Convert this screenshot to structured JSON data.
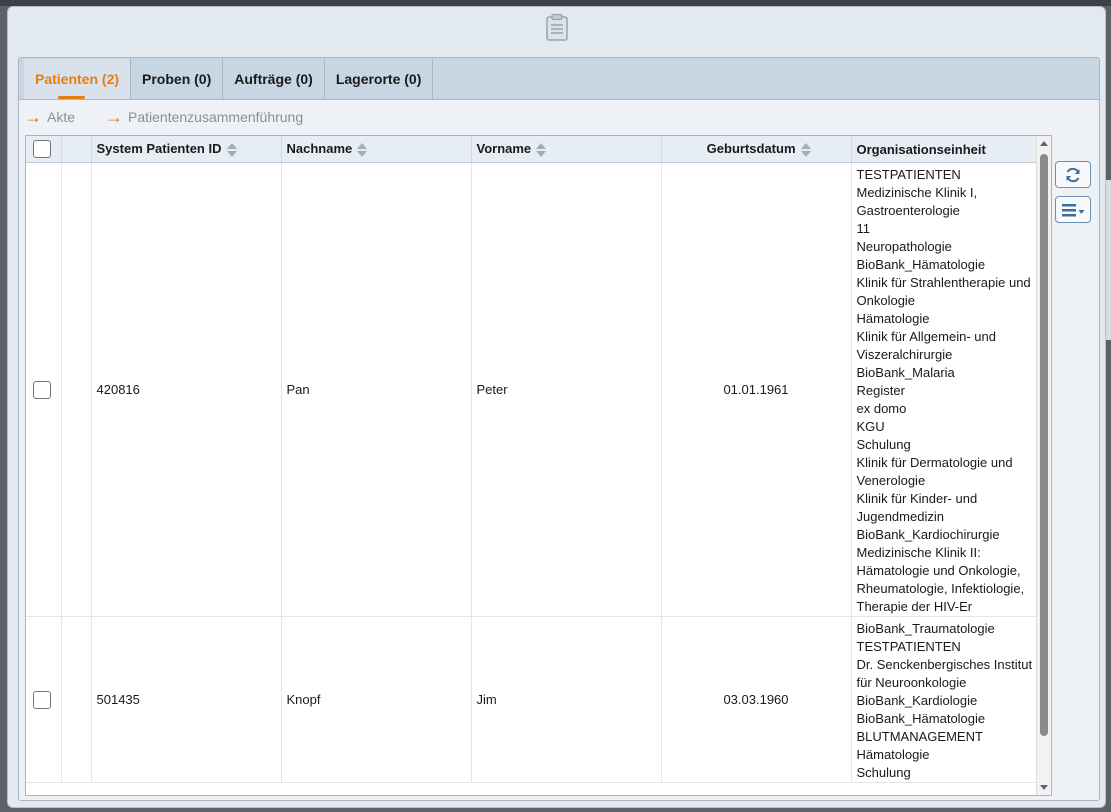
{
  "tabs": [
    {
      "label": "Patienten (2)"
    },
    {
      "label": "Proben (0)"
    },
    {
      "label": "Aufträge (0)"
    },
    {
      "label": "Lagerorte (0)"
    }
  ],
  "actions": {
    "akte_label": "Akte",
    "merge_label": "Patientenzusammenführung"
  },
  "table": {
    "columns": {
      "system_id": "System Patienten ID",
      "nachname": "Nachname",
      "vorname": "Vorname",
      "geburtsdatum": "Geburtsdatum",
      "org": "Organisationseinheit"
    },
    "rows": [
      {
        "system_id": "420816",
        "nachname": "Pan",
        "vorname": "Peter",
        "geburtsdatum": "01.01.1961",
        "org": [
          "TESTPATIENTEN",
          "Medizinische Klinik I, Gastroenterologie",
          "11",
          "Neuropathologie",
          "BioBank_Hämatologie",
          "Klinik für Strahlentherapie und Onkologie",
          "Hämatologie",
          "Klinik für Allgemein- und Viszeralchirurgie",
          "BioBank_Malaria",
          "Register",
          "ex domo",
          "KGU",
          "Schulung",
          "Klinik für Dermatologie und Venerologie",
          "Klinik für Kinder- und Jugendmedizin",
          "BioBank_Kardiochirurgie",
          "Medizinische Klinik II: Hämatologie und Onkologie, Rheumatologie, Infektiologie, Therapie der HIV-Er"
        ]
      },
      {
        "system_id": "501435",
        "nachname": "Knopf",
        "vorname": "Jim",
        "geburtsdatum": "03.03.1960",
        "org": [
          "BioBank_Traumatologie",
          "TESTPATIENTEN",
          "Dr. Senckenbergisches Institut für Neuroonkologie",
          "BioBank_Kardiologie",
          "BioBank_Hämatologie",
          "BLUTMANAGEMENT",
          "Hämatologie",
          "Schulung"
        ]
      }
    ]
  },
  "icons": {
    "header": "clipboard-icon",
    "action": "arrow-right-icon",
    "refresh": "refresh-icon",
    "menu": "list-menu-icon"
  },
  "colors": {
    "accent": "#e87d0d",
    "tabbar": "#c8d5e3",
    "button_border": "#6c8fb5"
  }
}
